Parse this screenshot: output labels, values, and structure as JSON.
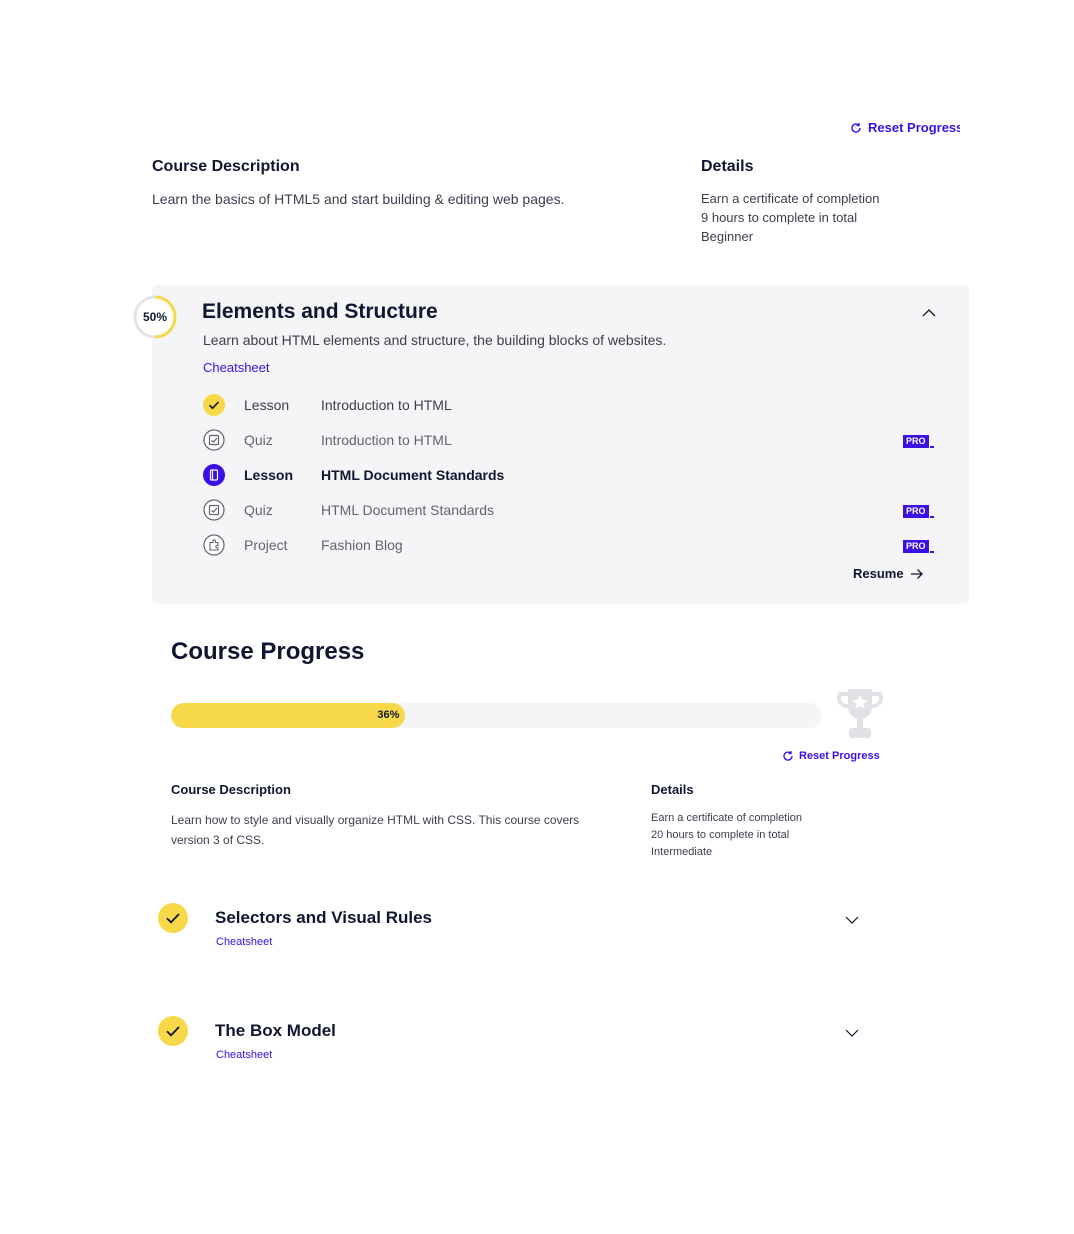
{
  "top_reset": {
    "label": "Reset Progress"
  },
  "course1": {
    "description_heading": "Course Description",
    "description": "Learn the basics of HTML5 and start building & editing web pages.",
    "details_heading": "Details",
    "details": [
      "Earn a certificate of completion",
      "9 hours to complete in total",
      "Beginner"
    ]
  },
  "module": {
    "percent": "50%",
    "percent_value": 0.5,
    "title": "Elements and Structure",
    "description": "Learn about HTML elements and structure, the building blocks of websites.",
    "cheatsheet": "Cheatsheet",
    "items": [
      {
        "type": "Lesson",
        "name": "Introduction to HTML",
        "status": "done",
        "icon": "check-circle-icon",
        "pro": false
      },
      {
        "type": "Quiz",
        "name": "Introduction to HTML",
        "status": "locked",
        "icon": "quiz-icon",
        "pro": true
      },
      {
        "type": "Lesson",
        "name": "HTML Document Standards",
        "status": "current",
        "icon": "lesson-icon",
        "pro": false
      },
      {
        "type": "Quiz",
        "name": "HTML Document Standards",
        "status": "locked",
        "icon": "quiz-icon",
        "pro": true
      },
      {
        "type": "Project",
        "name": "Fashion Blog",
        "status": "locked",
        "icon": "project-icon",
        "pro": true
      }
    ],
    "pro_label": "PRO",
    "resume": "Resume"
  },
  "progress": {
    "heading": "Course Progress",
    "percent": "36%",
    "percent_value": 0.36,
    "reset": "Reset Progress"
  },
  "course2": {
    "description_heading": "Course Description",
    "description": "Learn how to style and visually organize HTML with CSS. This course covers version 3 of CSS.",
    "details_heading": "Details",
    "details": [
      "Earn a certificate of completion",
      "20 hours to complete in total",
      "Intermediate"
    ]
  },
  "modules": [
    {
      "title": "Selectors and Visual Rules",
      "cheatsheet": "Cheatsheet",
      "complete": true
    },
    {
      "title": "The Box Model",
      "cheatsheet": "Cheatsheet",
      "complete": true
    }
  ],
  "colors": {
    "accent": "#3a10e5",
    "progress": "#f7d849",
    "card_bg": "#f5f5f8",
    "text": "#10162f"
  }
}
